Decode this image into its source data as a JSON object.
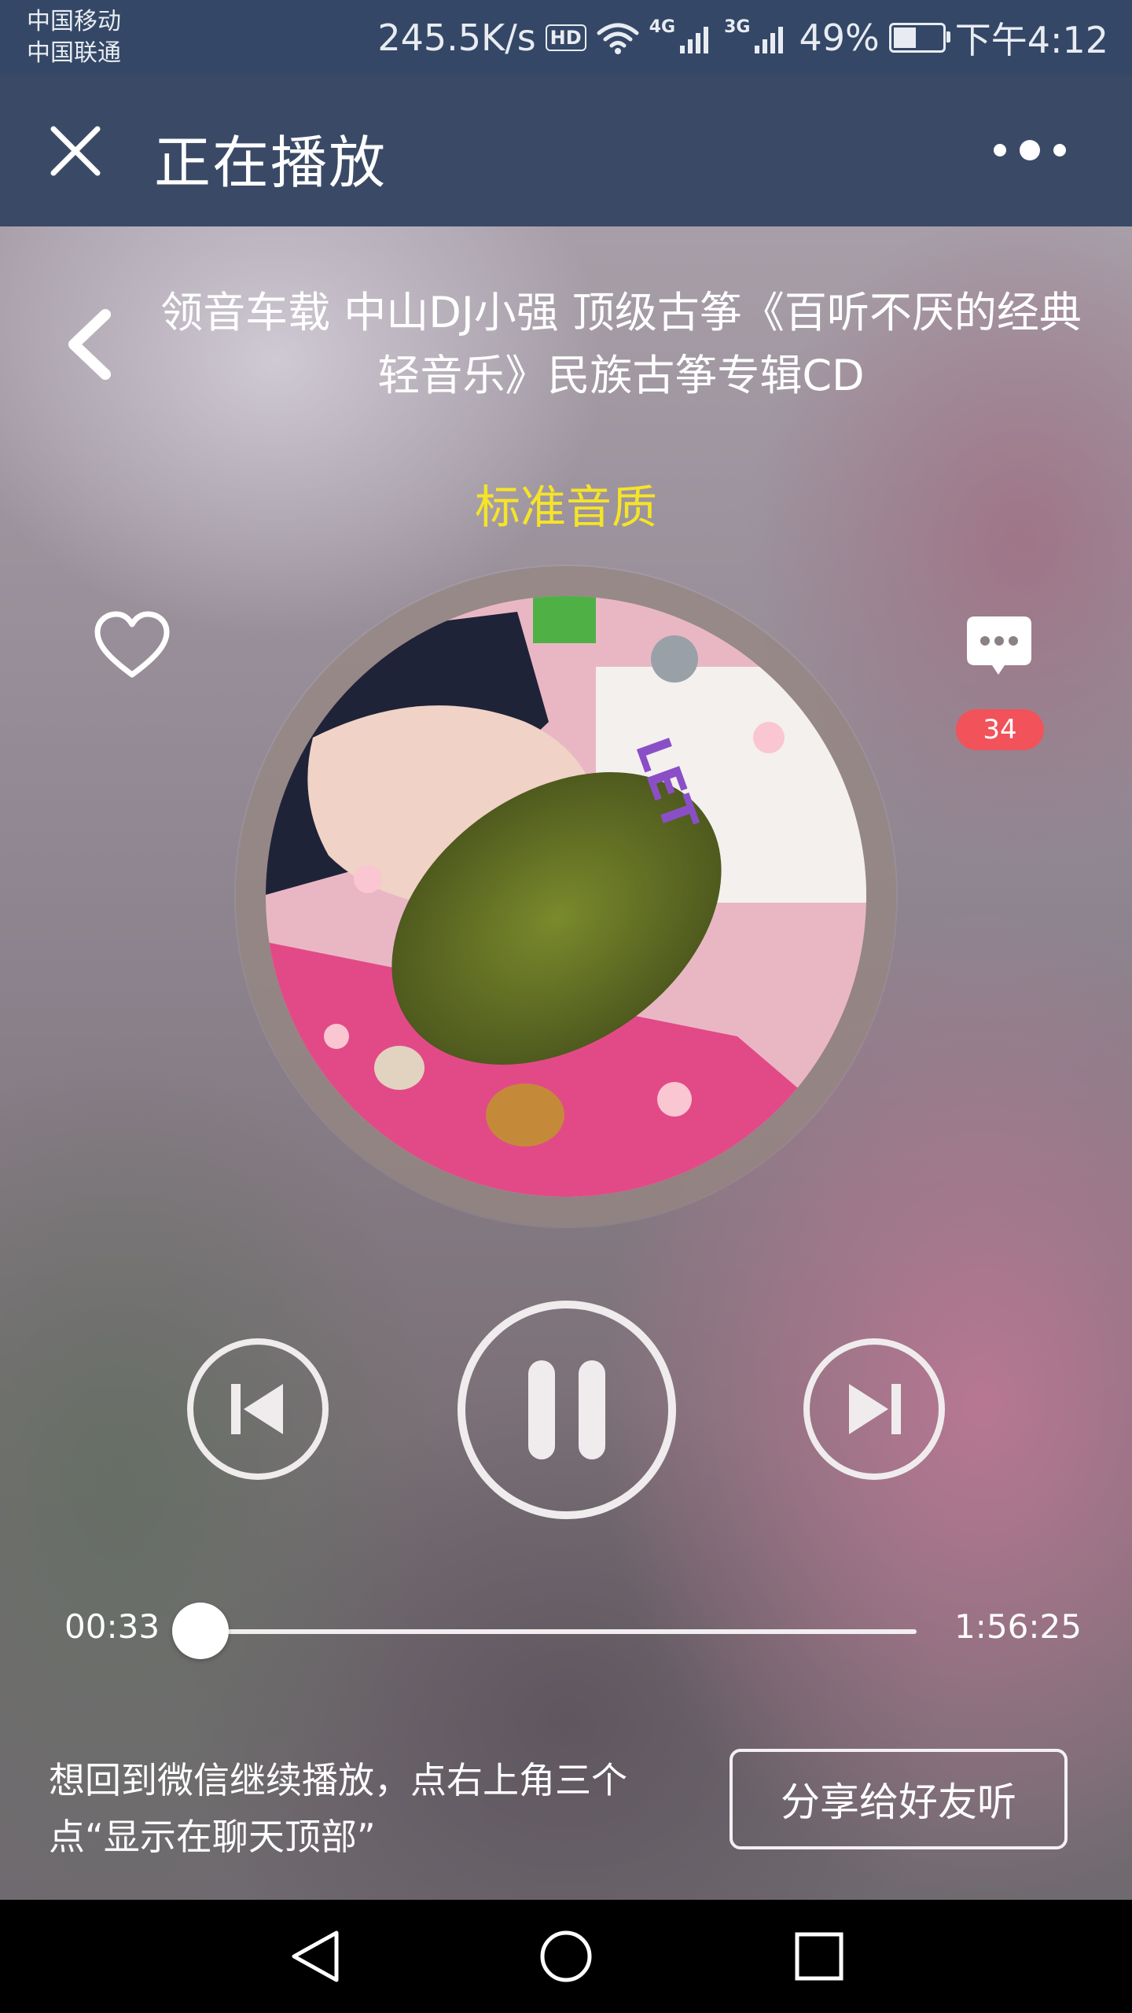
{
  "status_bar": {
    "carrier_1": "中国移动",
    "carrier_2": "中国联通",
    "speed": "245.5K/s",
    "hd": "HD",
    "net_4g": "4G",
    "net_3g": "3G",
    "battery": "49%",
    "time": "下午4:12",
    "battery_level": 0.49
  },
  "header": {
    "title": "正在播放",
    "close_icon": "close-icon",
    "more_icon": "more-icon"
  },
  "player": {
    "song_title": "领音车载 中山DJ小强 顶级古筝《百听不厌的经典轻音乐》民族古筝专辑CD",
    "quality": "标准音质",
    "comment_count": "34",
    "time_elapsed": "00:33",
    "time_total": "1:56:25",
    "progress": 0.005,
    "quality_color": "#f5e428",
    "badge_color": "#f2525a"
  },
  "footer": {
    "tip": "想回到微信继续播放，点右上角三个点“显示在聊天顶部”",
    "share_label": "分享给好友听"
  },
  "colors": {
    "status_bg": "#344766",
    "header_bg": "#3a4a66"
  }
}
